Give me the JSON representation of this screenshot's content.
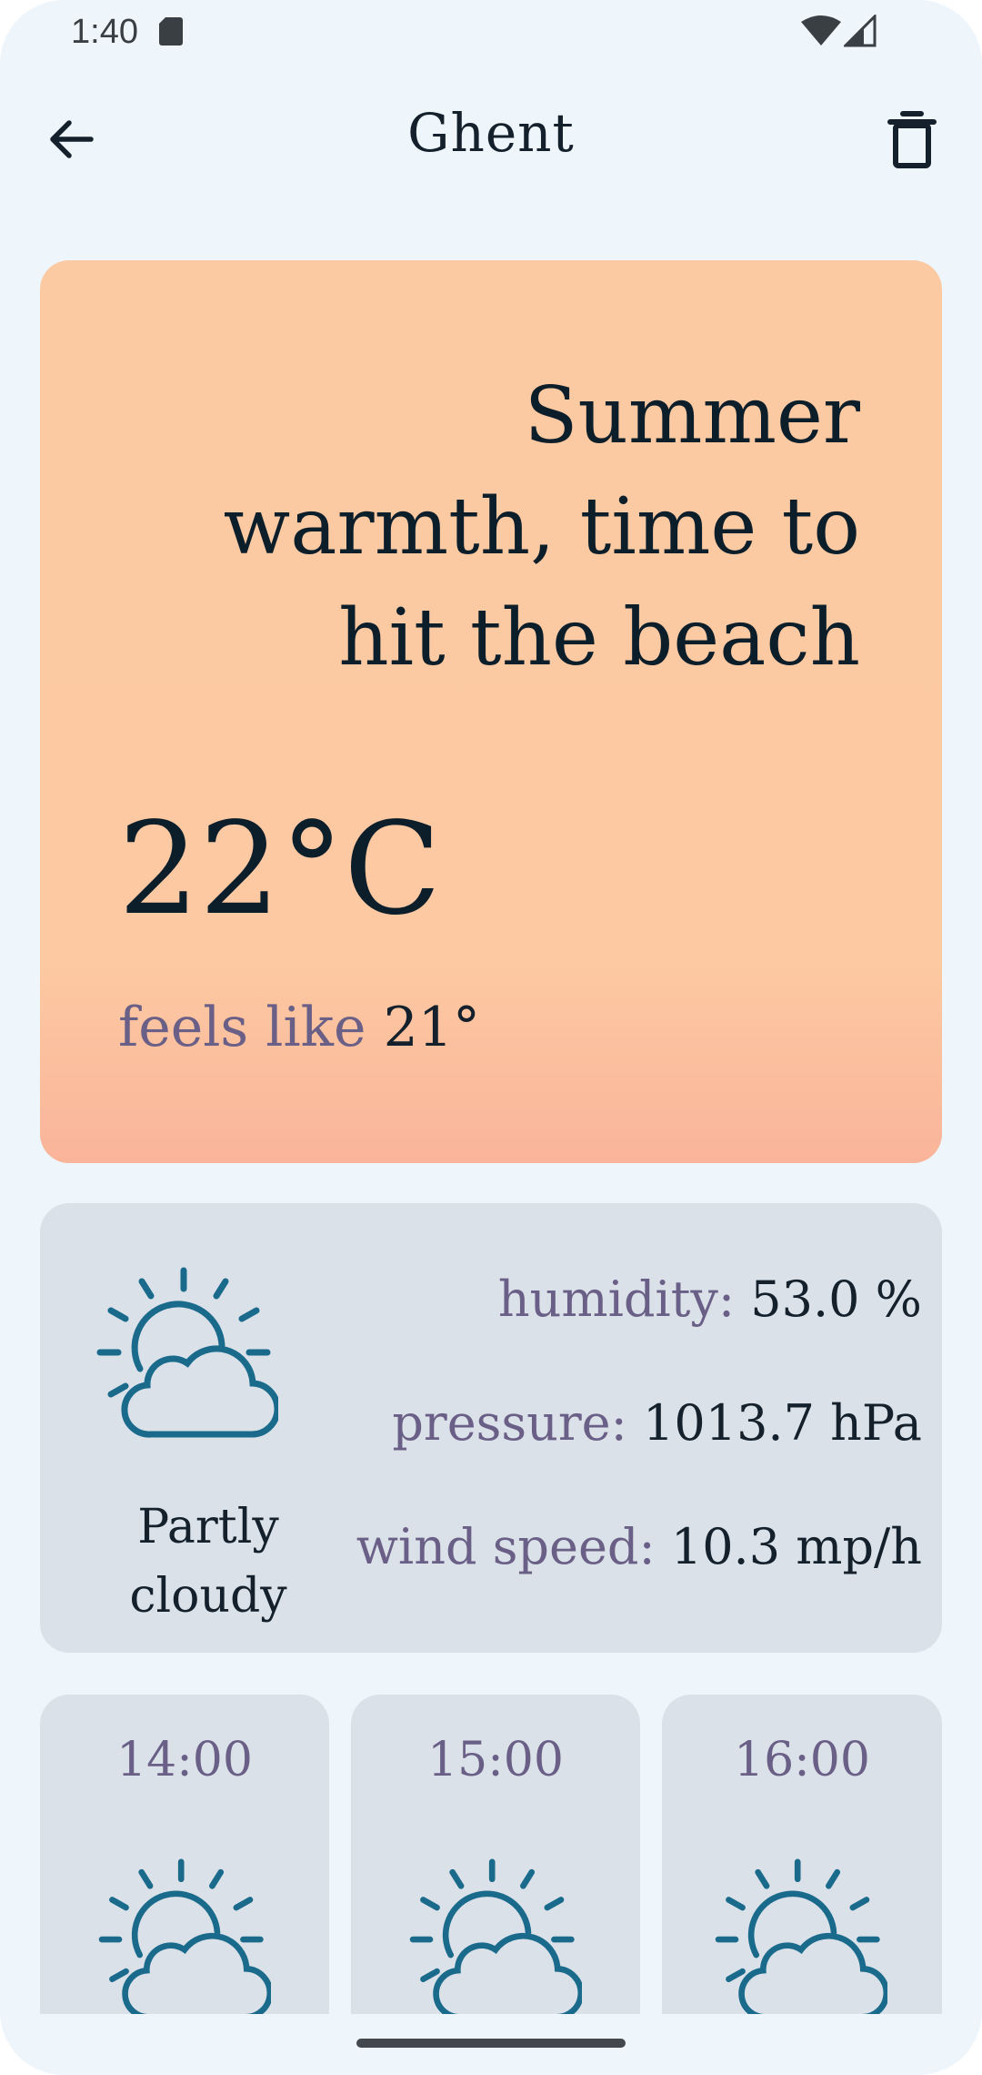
{
  "status_bar": {
    "time": "1:40"
  },
  "header": {
    "title": "Ghent"
  },
  "hero": {
    "message": "Summer warmth, time to hit the beach",
    "temperature": "22°C",
    "feels_like_label": "feels like",
    "feels_like_value": "21°"
  },
  "details": {
    "condition": "Partly cloudy",
    "condition_icon": "partly-cloudy-icon",
    "humidity_label": "humidity:",
    "humidity_value": "53.0 %",
    "pressure_label": "pressure:",
    "pressure_value": "1013.7 hPa",
    "wind_label": "wind speed:",
    "wind_value": "10.3 mp/h"
  },
  "hourly": [
    {
      "time": "14:00",
      "icon": "partly-cloudy-icon"
    },
    {
      "time": "15:00",
      "icon": "partly-cloudy-icon"
    },
    {
      "time": "16:00",
      "icon": "partly-cloudy-icon"
    }
  ],
  "colors": {
    "background": "#eef6fc",
    "hero_top": "#fccaa2",
    "hero_bottom": "#fab49a",
    "card": "#dbe1e8",
    "icon_stroke": "#1a6a8c",
    "label_purple": "#6a5f86"
  }
}
